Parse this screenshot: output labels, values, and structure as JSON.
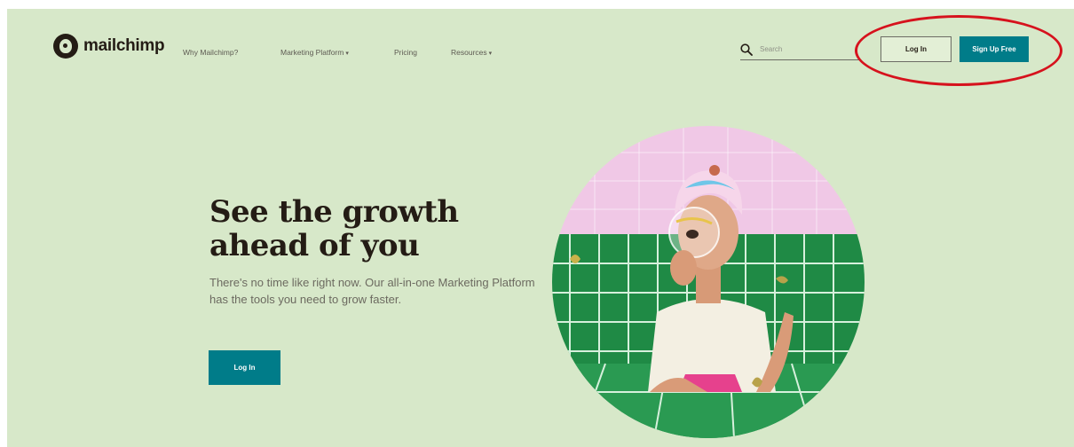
{
  "brand": {
    "name": "mailchimp"
  },
  "nav": {
    "items": [
      {
        "label": "Why Mailchimp?",
        "has_dropdown": false
      },
      {
        "label": "Marketing Platform",
        "has_dropdown": true
      },
      {
        "label": "Pricing",
        "has_dropdown": false
      },
      {
        "label": "Resources",
        "has_dropdown": true
      }
    ],
    "caret": "▾"
  },
  "search": {
    "placeholder": "Search",
    "value": ""
  },
  "header_actions": {
    "login_label": "Log In",
    "signup_label": "Sign Up Free"
  },
  "hero": {
    "title": "See the growth ahead of you",
    "body": "There's no time like right now. Our all-in-one Marketing Platform has the tools you need to grow faster.",
    "cta_label": "Log In"
  },
  "colors": {
    "background": "#d7e8c9",
    "accent_teal": "#007c89",
    "annotation_red": "#d6121d",
    "tile_green": "#1f8a45",
    "wall_pink": "#f0c8e6"
  },
  "icons": {
    "search": "search-icon",
    "logo": "mailchimp-logo-icon"
  }
}
